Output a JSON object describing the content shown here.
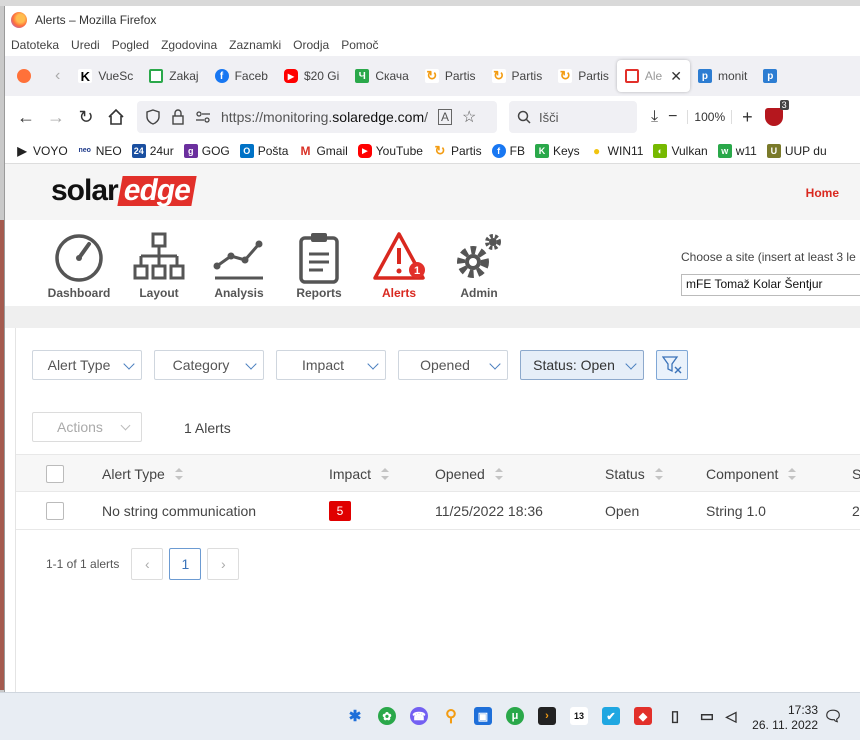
{
  "window": {
    "title": "Alerts – Mozilla Firefox"
  },
  "menu": [
    "Datoteka",
    "Uredi",
    "Pogled",
    "Zgodovina",
    "Zaznamki",
    "Orodja",
    "Pomoč"
  ],
  "tabs": [
    {
      "label": "VueSc",
      "icon": "k-icon",
      "color": "#000000"
    },
    {
      "label": "Zakaj",
      "icon": "page-icon",
      "color": "#2aa84a"
    },
    {
      "label": "Faceb",
      "icon": "facebook-icon",
      "color": "#1877f2"
    },
    {
      "label": "$20 Gi",
      "icon": "youtube-icon",
      "color": "#ff0000"
    },
    {
      "label": "Скача",
      "icon": "download-icon",
      "color": "#2aa84a"
    },
    {
      "label": "Partis",
      "icon": "partis-icon",
      "color": "#f39c12"
    },
    {
      "label": "Partis",
      "icon": "partis-icon",
      "color": "#f39c12"
    },
    {
      "label": "Partis",
      "icon": "partis-icon",
      "color": "#f39c12"
    },
    {
      "label": "Ale",
      "icon": "solaredge-icon",
      "color": "#e2302a",
      "active": true
    },
    {
      "label": "monit",
      "icon": "p-icon",
      "color": "#2d7dd2"
    }
  ],
  "navbar": {
    "url_prefix": "https://monitoring.",
    "url_domain": "solaredge.com",
    "url_suffix": "/",
    "search_placeholder": "Išči",
    "zoom": "100%",
    "ublock_count": "3"
  },
  "bookmarks": [
    {
      "label": "VOYO",
      "color": "#222222"
    },
    {
      "label": "NEO",
      "color": "#1e3a8a"
    },
    {
      "label": "24ur",
      "color": "#1a4fa0"
    },
    {
      "label": "GOG",
      "color": "#6b2f9e"
    },
    {
      "label": "Pošta",
      "color": "#0072c6"
    },
    {
      "label": "Gmail",
      "color": "#d93025"
    },
    {
      "label": "YouTube",
      "color": "#ff0000"
    },
    {
      "label": "Partis",
      "color": "#f39c12"
    },
    {
      "label": "FB",
      "color": "#1877f2"
    },
    {
      "label": "Keys",
      "color": "#2aa84a"
    },
    {
      "label": "WIN11",
      "color": "#f1c40f"
    },
    {
      "label": "Vulkan",
      "color": "#76b900"
    },
    {
      "label": "w11",
      "color": "#2aa84a"
    },
    {
      "label": "UUP du",
      "color": "#7a7a2a"
    }
  ],
  "site": {
    "home_link": "Home",
    "logo_part1": "solar",
    "logo_part2": "edge",
    "nav": [
      {
        "label": "Dashboard",
        "icon": "gauge-icon"
      },
      {
        "label": "Layout",
        "icon": "layout-tree-icon"
      },
      {
        "label": "Analysis",
        "icon": "chart-line-icon"
      },
      {
        "label": "Reports",
        "icon": "clipboard-icon"
      },
      {
        "label": "Alerts",
        "icon": "warning-icon",
        "badge": "1",
        "active": true
      },
      {
        "label": "Admin",
        "icon": "gears-icon"
      }
    ],
    "site_prompt": "Choose a site (insert at least 3 le",
    "site_value": "mFE Tomaž Kolar Šentjur"
  },
  "filters": {
    "alert_type": "Alert Type",
    "category": "Category",
    "impact": "Impact",
    "opened": "Opened",
    "status": "Status: Open"
  },
  "actions_label": "Actions",
  "alerts_count": "1 Alerts",
  "table": {
    "headers": [
      "Alert Type",
      "Impact",
      "Opened",
      "Status",
      "Component",
      "S"
    ],
    "rows": [
      {
        "alert_type": "No string communication",
        "impact": "5",
        "opened": "11/25/2022 18:36",
        "status": "Open",
        "component": "String 1.0",
        "extra": "2"
      }
    ]
  },
  "pagination": {
    "info": "1-1 of 1 alerts",
    "prev": "‹",
    "current": "1",
    "next": "›"
  },
  "taskbar": {
    "time": "17:33",
    "date": "26. 11. 2022",
    "badge": "13"
  },
  "colors": {
    "accent": "#e2302a",
    "home": "#d9281f",
    "impact_badge": "#e00000",
    "filter_selected": "#e6eef8"
  }
}
